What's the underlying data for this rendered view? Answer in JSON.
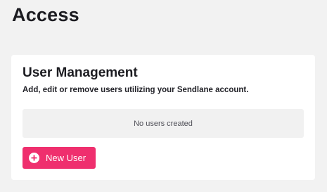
{
  "header": {
    "title": "Access"
  },
  "user_management": {
    "title": "User Management",
    "subtitle": "Add, edit or remove users utilizing your Sendlane account.",
    "empty_message": "No users created",
    "new_user_button": {
      "label": "New User",
      "icon": "plus-circle-icon"
    }
  },
  "colors": {
    "page_background": "#f2f2f2",
    "card_background": "#ffffff",
    "empty_state_background": "#f1f1f1",
    "accent": "#ef2f6e"
  }
}
